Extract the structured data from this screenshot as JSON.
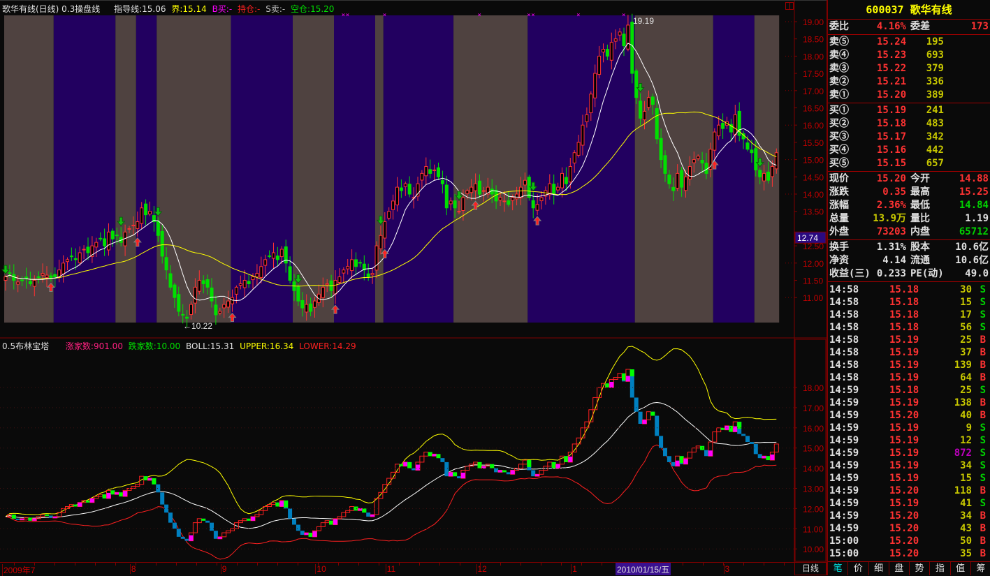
{
  "top_legend": {
    "title": "歌华有线(日线) 0.3操盘线",
    "guide": "指导线:15.06",
    "bound": "界:15.14",
    "buy": "B买:-",
    "hold": "持仓:-",
    "sell": "S卖:-",
    "empty": "空仓:15.20"
  },
  "bottom_legend": {
    "title": "0.5布林宝塔",
    "up_count": "涨家数:901.00",
    "down_count": "跌家数:10.00",
    "boll": "BOLL:15.31",
    "upper": "UPPER:16.34",
    "lower": "LOWER:14.29"
  },
  "colors": {
    "up": "#ff3232",
    "down": "#00e000",
    "band_brown": "#4f4240",
    "band_purple": "#220060",
    "ma_short": "#ffffff",
    "ma_long": "#ffff00",
    "tower_down": "#0080c0",
    "tower_magenta": "#ff00ff",
    "axis": "#800000"
  },
  "chart_data": [
    {
      "type": "candlestick",
      "y_ticks": [
        "19.00",
        "18.50",
        "18.00",
        "17.50",
        "17.00",
        "16.50",
        "16.00",
        "15.50",
        "15.00",
        "14.50",
        "14.00",
        "13.50",
        "12.74",
        "12.50",
        "12.00",
        "11.50",
        "11.00"
      ],
      "ylim": [
        10.1,
        19.2
      ],
      "cursor_price": "12.74",
      "high_label": "19.19",
      "low_label": "←10.22",
      "closes": [
        11.6,
        11.7,
        11.5,
        11.45,
        11.5,
        11.55,
        11.4,
        11.5,
        11.6,
        11.7,
        11.65,
        11.55,
        11.6,
        11.8,
        12.0,
        12.1,
        12.2,
        12.1,
        12.3,
        12.4,
        12.3,
        12.5,
        12.6,
        12.7,
        12.5,
        12.9,
        12.7,
        12.8,
        12.6,
        12.9,
        13.0,
        13.1,
        13.2,
        13.6,
        13.4,
        13.5,
        13.2,
        12.8,
        12.2,
        11.8,
        11.3,
        11.0,
        10.6,
        10.5,
        10.4,
        10.8,
        11.3,
        11.5,
        11.4,
        11.3,
        10.9,
        10.5,
        10.6,
        10.8,
        10.9,
        11.0,
        11.3,
        11.4,
        11.5,
        11.4,
        11.6,
        11.7,
        11.9,
        12.1,
        12.2,
        12.3,
        12.1,
        12.4,
        12.0,
        11.5,
        11.2,
        10.9,
        10.7,
        10.8,
        10.6,
        10.9,
        11.1,
        11.3,
        11.4,
        11.2,
        11.5,
        11.6,
        11.8,
        11.9,
        12.1,
        11.9,
        12.0,
        11.8,
        11.6,
        11.7,
        12.5,
        12.8,
        13.2,
        13.5,
        13.8,
        14.2,
        14.1,
        14.3,
        14.0,
        13.9,
        14.3,
        14.6,
        14.8,
        14.6,
        14.7,
        14.5,
        14.3,
        13.6,
        13.8,
        13.6,
        13.5,
        13.9,
        14.1,
        14.2,
        14.3,
        14.0,
        14.1,
        14.2,
        14.0,
        13.8,
        13.9,
        13.8,
        13.7,
        13.9,
        14.0,
        14.2,
        14.4,
        13.9,
        13.6,
        13.7,
        13.9,
        14.1,
        14.3,
        14.0,
        14.2,
        14.6,
        14.3,
        14.8,
        15.2,
        15.5,
        16.0,
        16.3,
        16.9,
        17.5,
        18.0,
        18.2,
        18.0,
        18.4,
        18.5,
        18.7,
        18.3,
        18.9,
        17.5,
        16.8,
        16.2,
        16.4,
        16.8,
        16.6,
        15.6,
        15.0,
        14.6,
        14.3,
        14.1,
        14.6,
        14.2,
        14.5,
        14.8,
        15.0,
        15.1,
        14.9,
        14.6,
        15.3,
        15.8,
        16.0,
        15.9,
        16.1,
        15.8,
        16.3,
        15.7,
        15.6,
        15.3,
        15.2,
        14.7,
        14.5,
        14.6,
        14.4,
        14.8,
        15.2
      ],
      "regions": [
        {
          "from": 0,
          "to": 12,
          "color": "#4f4240"
        },
        {
          "from": 12,
          "to": 27,
          "color": "#220060"
        },
        {
          "from": 27,
          "to": 32,
          "color": "#4f4240"
        },
        {
          "from": 32,
          "to": 37,
          "color": "#220060"
        },
        {
          "from": 37,
          "to": 55,
          "color": "#4f4240"
        },
        {
          "from": 55,
          "to": 70,
          "color": "#220060"
        },
        {
          "from": 70,
          "to": 80,
          "color": "#4f4240"
        },
        {
          "from": 80,
          "to": 90,
          "color": "#220060"
        },
        {
          "from": 90,
          "to": 92,
          "color": "#4f4240"
        },
        {
          "from": 92,
          "to": 109,
          "color": "#220060"
        },
        {
          "from": 109,
          "to": 127,
          "color": "#4f4240"
        },
        {
          "from": 127,
          "to": 153,
          "color": "#220060"
        },
        {
          "from": 153,
          "to": 172,
          "color": "#4f4240"
        },
        {
          "from": 172,
          "to": 182,
          "color": "#220060"
        },
        {
          "from": 182,
          "to": 188,
          "color": "#4f4240"
        }
      ],
      "sell_signals": [
        0,
        28,
        37,
        71,
        91,
        110,
        128,
        154,
        183
      ],
      "buy_signals": [
        11,
        32,
        55,
        80,
        92,
        114,
        129,
        172
      ],
      "top_markers": [
        82,
        83,
        92,
        115,
        127,
        128,
        139,
        150
      ]
    },
    {
      "type": "bollinger_tower",
      "y_ticks": [
        "18.00",
        "17.00",
        "16.00",
        "15.00",
        "14.00",
        "13.00",
        "12.00",
        "11.00",
        "10.00"
      ],
      "ylim": [
        9.7,
        19.8
      ]
    }
  ],
  "x_axis": {
    "labels": [
      {
        "text": "2009年7",
        "bar": 0
      },
      {
        "text": "8",
        "bar": 31
      },
      {
        "text": "9",
        "bar": 53
      },
      {
        "text": "10",
        "bar": 76
      },
      {
        "text": "11",
        "bar": 93
      },
      {
        "text": "12",
        "bar": 115
      },
      {
        "text": "1",
        "bar": 138
      },
      {
        "text": "3",
        "bar": 175
      }
    ],
    "cursor_date": "2010/01/15/五",
    "period": "日线"
  },
  "quote": {
    "code_name": "600037 歌华有线",
    "weibi_label": "委比",
    "weibi": "4.16%",
    "weicha_label": "委差",
    "weicha": "173",
    "asks": [
      {
        "label": "卖⑤",
        "price": "15.24",
        "vol": "195"
      },
      {
        "label": "卖④",
        "price": "15.23",
        "vol": "693"
      },
      {
        "label": "卖③",
        "price": "15.22",
        "vol": "379"
      },
      {
        "label": "卖②",
        "price": "15.21",
        "vol": "336"
      },
      {
        "label": "卖①",
        "price": "15.20",
        "vol": "389"
      }
    ],
    "bids": [
      {
        "label": "买①",
        "price": "15.19",
        "vol": "241"
      },
      {
        "label": "买②",
        "price": "15.18",
        "vol": "483"
      },
      {
        "label": "买③",
        "price": "15.17",
        "vol": "342"
      },
      {
        "label": "买④",
        "price": "15.16",
        "vol": "442"
      },
      {
        "label": "买⑤",
        "price": "15.15",
        "vol": "657"
      }
    ],
    "stats": [
      {
        "l1": "现价",
        "v1": "15.20",
        "c1": "#ff3232",
        "l2": "今开",
        "v2": "14.88",
        "c2": "#ff3232"
      },
      {
        "l1": "涨跌",
        "v1": "0.35",
        "c1": "#ff3232",
        "l2": "最高",
        "v2": "15.25",
        "c2": "#ff3232"
      },
      {
        "l1": "涨幅",
        "v1": "2.36%",
        "c1": "#ff3232",
        "l2": "最低",
        "v2": "14.84",
        "c2": "#00d000"
      },
      {
        "l1": "总量",
        "v1": "13.9万",
        "c1": "#c8c800",
        "l2": "量比",
        "v2": "1.19",
        "c2": "#e0e0e0"
      },
      {
        "l1": "外盘",
        "v1": "73203",
        "c1": "#ff3232",
        "l2": "内盘",
        "v2": "65712",
        "c2": "#00d000"
      }
    ],
    "fundamentals": [
      {
        "l1": "换手",
        "v1": "1.31%",
        "l2": "股本",
        "v2": "10.6亿"
      },
      {
        "l1": "净资",
        "v1": "4.14",
        "l2": "流通",
        "v2": "10.6亿"
      },
      {
        "l1": "收益(三)",
        "v1": "0.233",
        "l2": "PE(动)",
        "v2": "49.0"
      }
    ]
  },
  "ticks": [
    {
      "time": "14:58",
      "price": "15.18",
      "vol": "30",
      "side": "S"
    },
    {
      "time": "14:58",
      "price": "15.18",
      "vol": "15",
      "side": "S"
    },
    {
      "time": "14:58",
      "price": "15.18",
      "vol": "17",
      "side": "S"
    },
    {
      "time": "14:58",
      "price": "15.18",
      "vol": "56",
      "side": "S"
    },
    {
      "time": "14:58",
      "price": "15.19",
      "vol": "25",
      "side": "B"
    },
    {
      "time": "14:58",
      "price": "15.19",
      "vol": "37",
      "side": "B"
    },
    {
      "time": "14:58",
      "price": "15.19",
      "vol": "139",
      "side": "B"
    },
    {
      "time": "14:58",
      "price": "15.19",
      "vol": "64",
      "side": "B"
    },
    {
      "time": "14:59",
      "price": "15.18",
      "vol": "25",
      "side": "S"
    },
    {
      "time": "14:59",
      "price": "15.19",
      "vol": "138",
      "side": "B"
    },
    {
      "time": "14:59",
      "price": "15.20",
      "vol": "40",
      "side": "B"
    },
    {
      "time": "14:59",
      "price": "15.19",
      "vol": "9",
      "side": "S"
    },
    {
      "time": "14:59",
      "price": "15.19",
      "vol": "12",
      "side": "S"
    },
    {
      "time": "14:59",
      "price": "15.19",
      "vol": "872",
      "side": "S",
      "big": true
    },
    {
      "time": "14:59",
      "price": "15.19",
      "vol": "34",
      "side": "S"
    },
    {
      "time": "14:59",
      "price": "15.19",
      "vol": "15",
      "side": "S"
    },
    {
      "time": "14:59",
      "price": "15.20",
      "vol": "118",
      "side": "B"
    },
    {
      "time": "14:59",
      "price": "15.19",
      "vol": "41",
      "side": "S"
    },
    {
      "time": "14:59",
      "price": "15.20",
      "vol": "34",
      "side": "B"
    },
    {
      "time": "14:59",
      "price": "15.20",
      "vol": "43",
      "side": "B"
    },
    {
      "time": "15:00",
      "price": "15.20",
      "vol": "50",
      "side": "B"
    },
    {
      "time": "15:00",
      "price": "15.20",
      "vol": "35",
      "side": "B"
    }
  ],
  "tabs": [
    "笔",
    "价",
    "细",
    "盘",
    "势",
    "指",
    "值",
    "筹"
  ]
}
